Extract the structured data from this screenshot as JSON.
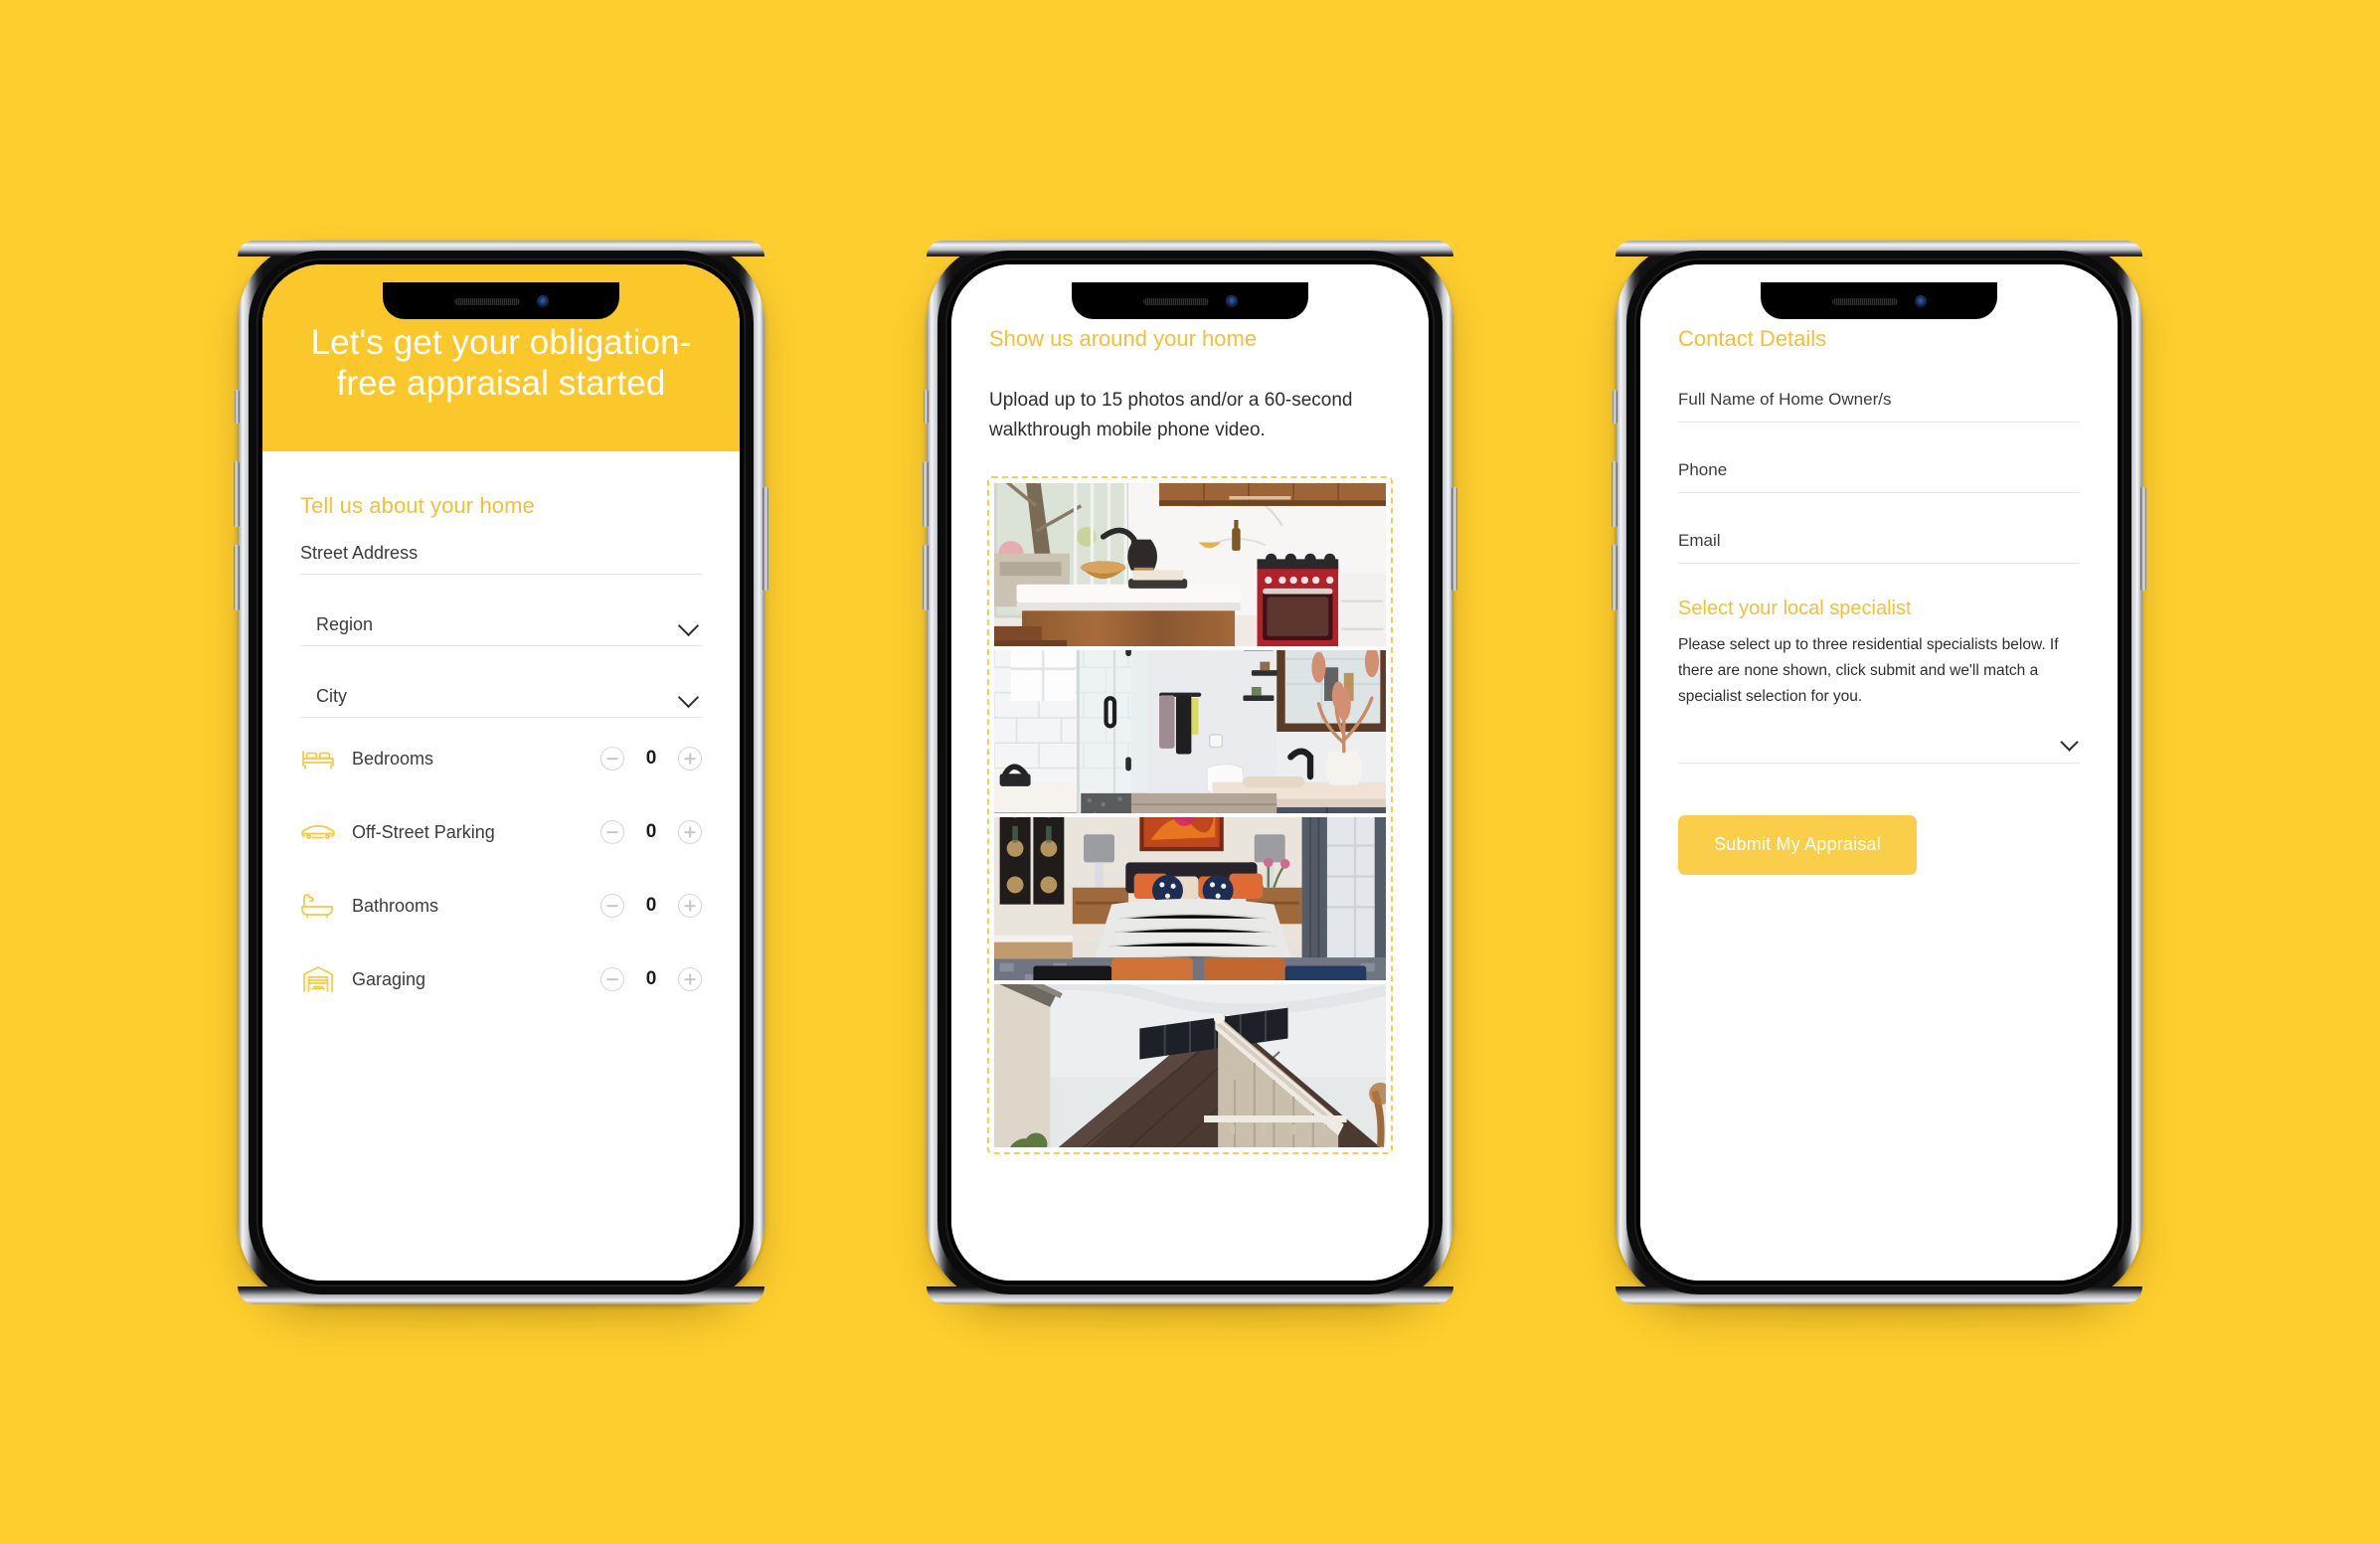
{
  "theme": {
    "background": "#FDCE2E",
    "hero_yellow": "#FBC82C",
    "accent_heading": "#F2C037",
    "button_yellow": "#FBCE4A",
    "text_dark": "#2e2e2e",
    "rule_grey": "#e6e6e6"
  },
  "phone1": {
    "hero_title": "Let's get your obligation-free appraisal started",
    "section_heading": "Tell us about your home",
    "fields": [
      {
        "label": "Street Address",
        "type": "text"
      },
      {
        "label": "Region",
        "type": "select"
      },
      {
        "label": "City",
        "type": "select"
      }
    ],
    "counters": [
      {
        "icon": "bed-icon",
        "label": "Bedrooms",
        "value": "0"
      },
      {
        "icon": "car-icon",
        "label": "Off-Street Parking",
        "value": "0"
      },
      {
        "icon": "bathtub-icon",
        "label": "Bathrooms",
        "value": "0"
      },
      {
        "icon": "garage-icon",
        "label": "Garaging",
        "value": "0"
      }
    ],
    "stepper": {
      "decrement": "−",
      "increment": "+"
    }
  },
  "phone2": {
    "title": "Show us around your home",
    "body": "Upload up to 15 photos and/or a 60-second walkthrough mobile phone video.",
    "photos": [
      {
        "name": "kitchen-photo",
        "alt": "Modern kitchen with white stone island, walnut cabinetry and a red range"
      },
      {
        "name": "bathroom-photo",
        "alt": "Bathroom with glass shower, white subway tile and navy vanity"
      },
      {
        "name": "bedroom-photo",
        "alt": "Bedroom with orange and navy cushions and upholstered benches"
      },
      {
        "name": "exterior-photo",
        "alt": "House exterior roofline with solar panels"
      }
    ]
  },
  "phone3": {
    "title": "Contact Details",
    "fields": [
      {
        "label": "Full Name of Home Owner/s",
        "type": "text"
      },
      {
        "label": "Phone",
        "type": "text"
      },
      {
        "label": "Email",
        "type": "text"
      }
    ],
    "specialist_heading": "Select your local specialist",
    "specialist_body": "Please select up to three residential specialists below. If there are none shown, click submit and we'll match a specialist selection for you.",
    "specialist_select_value": "",
    "submit_label": "Submit My Appraisal"
  }
}
